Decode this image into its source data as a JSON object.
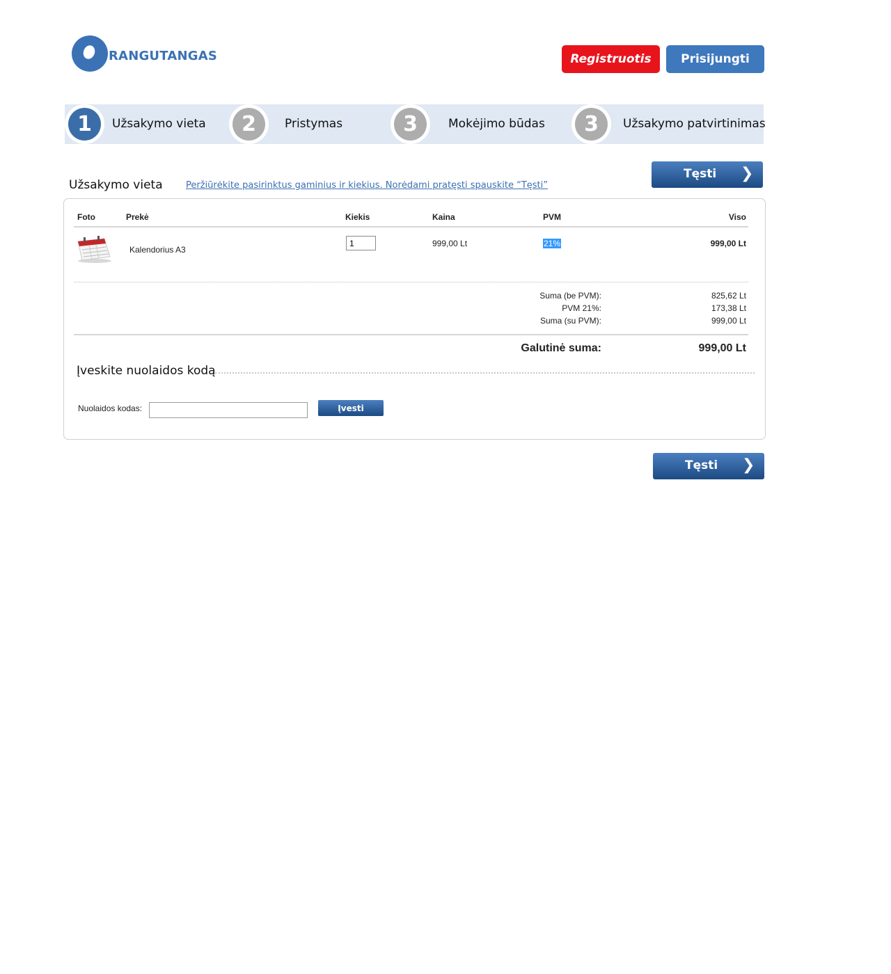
{
  "brand": {
    "name": "RANGUTANGAS"
  },
  "header": {
    "register_label": "Registruotis",
    "login_label": "Prisijungti"
  },
  "steps": [
    {
      "number": "1",
      "label": "Užsakymo vieta",
      "active": true
    },
    {
      "number": "2",
      "label": "Pristymas",
      "active": false
    },
    {
      "number": "3",
      "label": "Mokėjimo būdas",
      "active": false
    },
    {
      "number": "3",
      "label": "Užsakymo patvirtinimas",
      "active": false
    }
  ],
  "section": {
    "title": "Užsakymo vieta",
    "hint": "Peržiūrėkite pasirinktus gaminius ir kiekius. Norėdami pratęsti spauskite “Tęsti”",
    "next_label": "Tęsti"
  },
  "table": {
    "headers": {
      "photo": "Foto",
      "product": "Prekė",
      "qty": "Kiekis",
      "price": "Kaina",
      "vat": "PVM",
      "total": "Viso"
    },
    "rows": [
      {
        "product": "Kalendorius A3",
        "qty": "1",
        "price": "999,00 Lt",
        "vat": "21%",
        "total": "999,00 Lt"
      }
    ]
  },
  "summary": {
    "net_label": "Suma (be PVM):",
    "net_value": "825,62 Lt",
    "vat_label": "PVM 21%:",
    "vat_value": "173,38 Lt",
    "gross_label": "Suma (su PVM):",
    "gross_value": "999,00 Lt",
    "grand_label": "Galutinė suma:",
    "grand_value": "999,00 Lt"
  },
  "discount": {
    "title": "Įveskite nuolaidos kodą",
    "label": "Nuolaidos kodas:",
    "value": "",
    "apply_label": "Įvesti"
  },
  "colors": {
    "brand_blue": "#3b72b5",
    "register_red": "#e8141c",
    "step_active": "#3b6ea8",
    "step_inactive": "#adadad",
    "steps_bg": "#dfe8f3"
  }
}
